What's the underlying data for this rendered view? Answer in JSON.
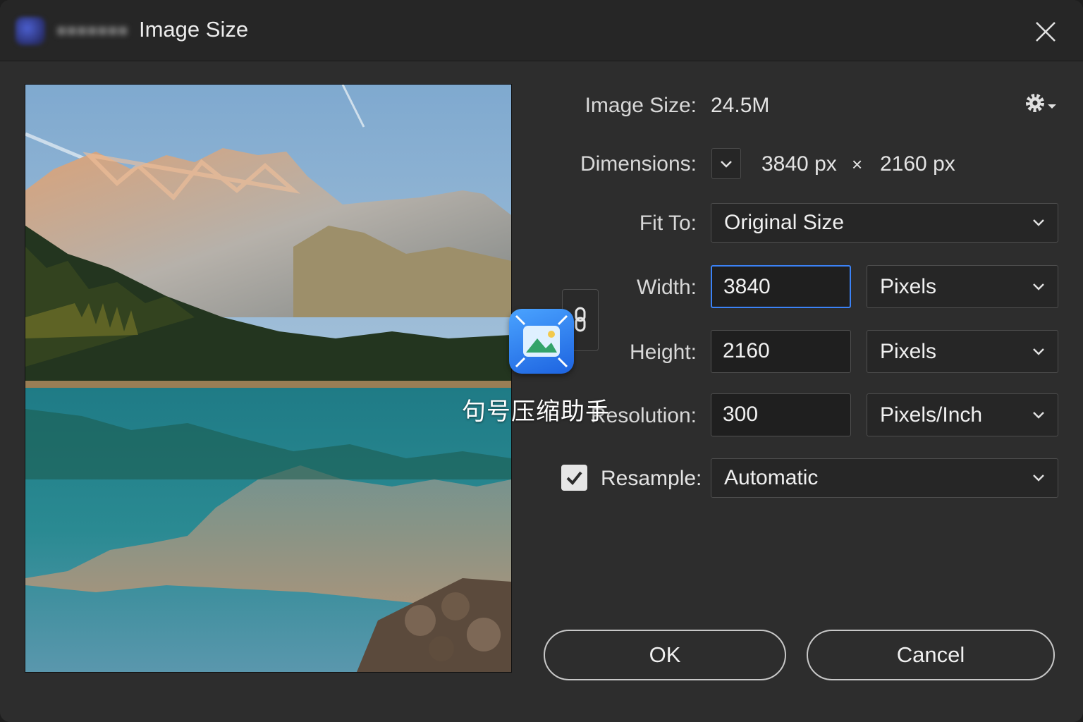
{
  "window": {
    "title": "Image Size"
  },
  "info": {
    "image_size_label": "Image Size:",
    "image_size_value": "24.5M",
    "dimensions_label": "Dimensions:",
    "dim_width": "3840 px",
    "dim_sep": "×",
    "dim_height": "2160 px"
  },
  "form": {
    "fit_to_label": "Fit To:",
    "fit_to_value": "Original Size",
    "width_label": "Width:",
    "width_value": "3840",
    "width_unit": "Pixels",
    "height_label": "Height:",
    "height_value": "2160",
    "height_unit": "Pixels",
    "resolution_label": "Resolution:",
    "resolution_value": "300",
    "resolution_unit": "Pixels/Inch",
    "resample_label": "Resample:",
    "resample_checked": true,
    "resample_value": "Automatic"
  },
  "buttons": {
    "ok": "OK",
    "cancel": "Cancel"
  },
  "watermark": {
    "text": "句号压缩助手"
  },
  "colors": {
    "focus": "#3b82f6",
    "dialog_bg": "#2d2d2d",
    "title_bg": "#262626"
  },
  "icons": [
    "app-logo-icon",
    "close-icon",
    "gear-icon",
    "chevron-down-icon",
    "link-chain-icon",
    "checkmark-icon",
    "compress-app-icon"
  ]
}
